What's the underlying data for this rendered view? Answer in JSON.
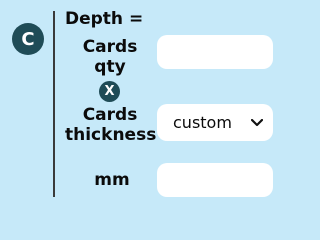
{
  "badge": {
    "letter": "C"
  },
  "formula": {
    "depth_label": "Depth =",
    "cards_qty_label_line1": "Cards",
    "cards_qty_label_line2": "qty",
    "multiply_symbol": "X",
    "cards_thickness_label_line1": "Cards",
    "cards_thickness_label_line2": "thickness",
    "result_unit": "mm"
  },
  "inputs": {
    "cards_qty": {
      "value": "",
      "placeholder": ""
    },
    "thickness": {
      "selected": "custom"
    },
    "result": {
      "value": "",
      "placeholder": ""
    }
  },
  "icons": {
    "dropdown": "chevron-down-icon"
  },
  "colors": {
    "background": "#c6e9f9",
    "badge": "#1f4c57",
    "field": "#ffffff"
  }
}
